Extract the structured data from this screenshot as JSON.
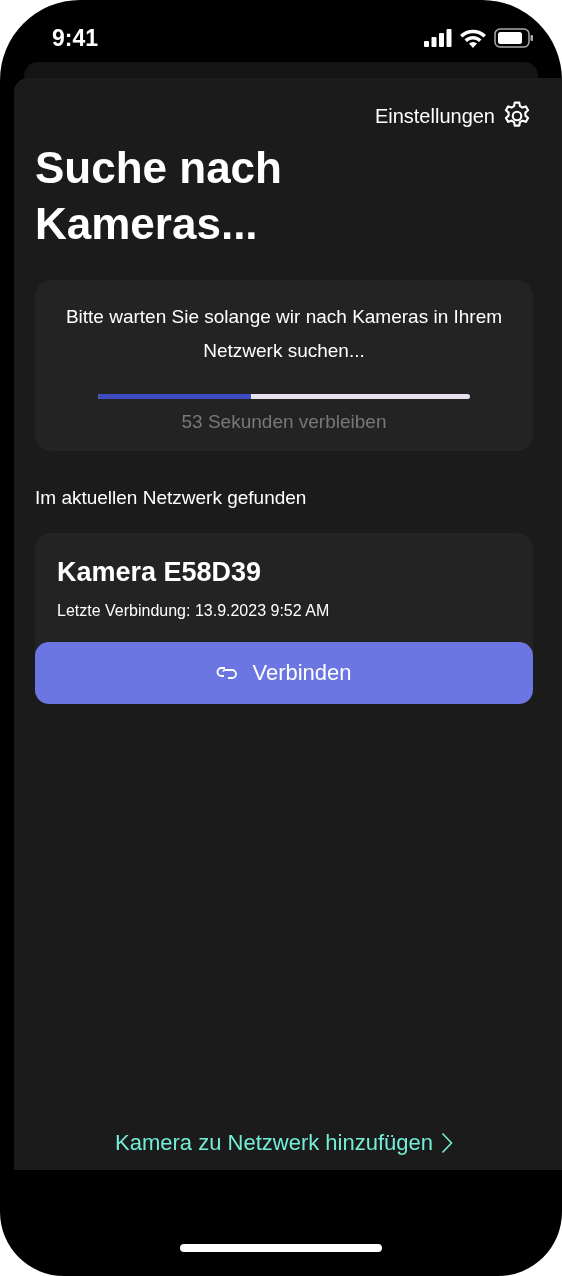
{
  "status_bar": {
    "time": "9:41"
  },
  "settings_link": {
    "label": "Einstellungen"
  },
  "title": "Suche nach Kameras...",
  "search_card": {
    "message": "Bitte warten Sie solange wir nach Kameras in Ihrem Netzwerk suchen...",
    "progress": {
      "level": 0.41
    },
    "remaining": "53 Sekunden verbleiben"
  },
  "found_heading": "Im aktuellen Netzwerk gefunden",
  "cameras": [
    {
      "name": "Kamera E58D39",
      "last_connection": "Letzte Verbindung: 13.9.2023 9:52 AM",
      "button": "Verbinden"
    }
  ],
  "add_camera_link": "Kamera zu Netzwerk hinzufügen"
}
